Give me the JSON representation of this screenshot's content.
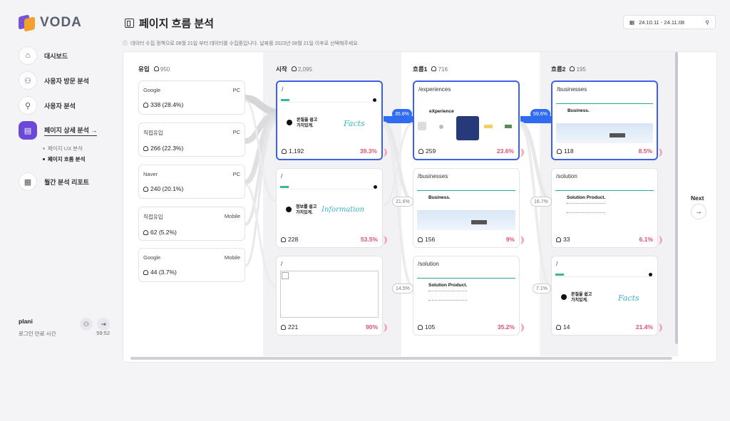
{
  "app": {
    "logo_text": "VODA"
  },
  "sidebar": {
    "items": [
      {
        "label": "대시보드",
        "icon": "home-icon"
      },
      {
        "label": "사용자 방문 분석",
        "icon": "user-plus-icon"
      },
      {
        "label": "사용자 분석",
        "icon": "user-search-icon"
      },
      {
        "label": "페이지 상세 분석 →",
        "icon": "page-icon",
        "active": true
      },
      {
        "label": "월간 분석 리포트",
        "icon": "report-icon"
      }
    ],
    "sub_items": [
      {
        "label": "페이지 UX 분석"
      },
      {
        "label": "페이지 흐름 분석",
        "active": true
      }
    ],
    "user": {
      "name": "plani",
      "session_label": "로그인 만료 시간",
      "session_time": "59:52"
    }
  },
  "header": {
    "title": "페이지 흐름 분석",
    "date_range": "24.10.11 - 24.11.08",
    "notice": "데이터 수집 정책으로 08월 21일 부터 데이터를 수집중입니다. 날짜를 2023년 08월 21일 이후로 선택해주세요."
  },
  "columns": {
    "source": {
      "label": "유입",
      "count": "950"
    },
    "start": {
      "label": "시작",
      "count": "2,095"
    },
    "flow1": {
      "label": "흐름1",
      "count": "716"
    },
    "flow2": {
      "label": "흐름2",
      "count": "195"
    }
  },
  "sources": [
    {
      "name": "Google",
      "device": "PC",
      "value": "338 (28.4%)"
    },
    {
      "name": "직접유입",
      "device": "PC",
      "value": "266 (22.3%)"
    },
    {
      "name": "Naver",
      "device": "PC",
      "value": "240 (20.1%)"
    },
    {
      "name": "직접유입",
      "device": "Mobile",
      "value": "62 (5.2%)"
    },
    {
      "name": "Google",
      "device": "Mobile",
      "value": "44 (3.7%)"
    }
  ],
  "start_pages": [
    {
      "path": "/",
      "users": "1,192",
      "pct": "39.3%",
      "thumb": "facts",
      "thumb_text": "본질을 쉽고\n가치있게.",
      "script": "Facts"
    },
    {
      "path": "/",
      "users": "228",
      "pct": "53.5%",
      "thumb": "info",
      "thumb_text": "정보를 쉽고\n가치있게.",
      "script": "Information"
    },
    {
      "path": "/",
      "users": "221",
      "pct": "90%",
      "thumb": "broken"
    }
  ],
  "flow1_pages": [
    {
      "path": "/experiences",
      "users": "259",
      "pct": "23.6%",
      "thumb": "experience",
      "thumb_text": "eXperience"
    },
    {
      "path": "/businesses",
      "users": "156",
      "pct": "9%",
      "thumb": "business",
      "thumb_text": "Business."
    },
    {
      "path": "/solution",
      "users": "105",
      "pct": "35.2%",
      "thumb": "solution",
      "thumb_text": "Solution Product."
    }
  ],
  "flow2_pages": [
    {
      "path": "/businesses",
      "users": "118",
      "pct": "8.5%",
      "thumb": "business",
      "thumb_text": "Business."
    },
    {
      "path": "/solution",
      "users": "33",
      "pct": "6.1%",
      "thumb": "solution",
      "thumb_text": "Solution Product."
    },
    {
      "path": "/",
      "users": "14",
      "pct": "21.4%",
      "thumb": "facts",
      "thumb_text": "본질을 쉽고\n가치있게.",
      "script": "Facts"
    }
  ],
  "flow_rates": {
    "start_to_flow1": [
      "35.8%",
      "21.6%",
      "14.5%"
    ],
    "flow1_to_flow2": [
      "59.6%",
      "16.7%",
      "7.1%"
    ]
  },
  "next_label": "Next",
  "colors": {
    "accent": "#6b48d8",
    "flow_blue": "#2f6cf2",
    "card_border_selected": "#3c60e8",
    "pct_red": "#e05070"
  }
}
